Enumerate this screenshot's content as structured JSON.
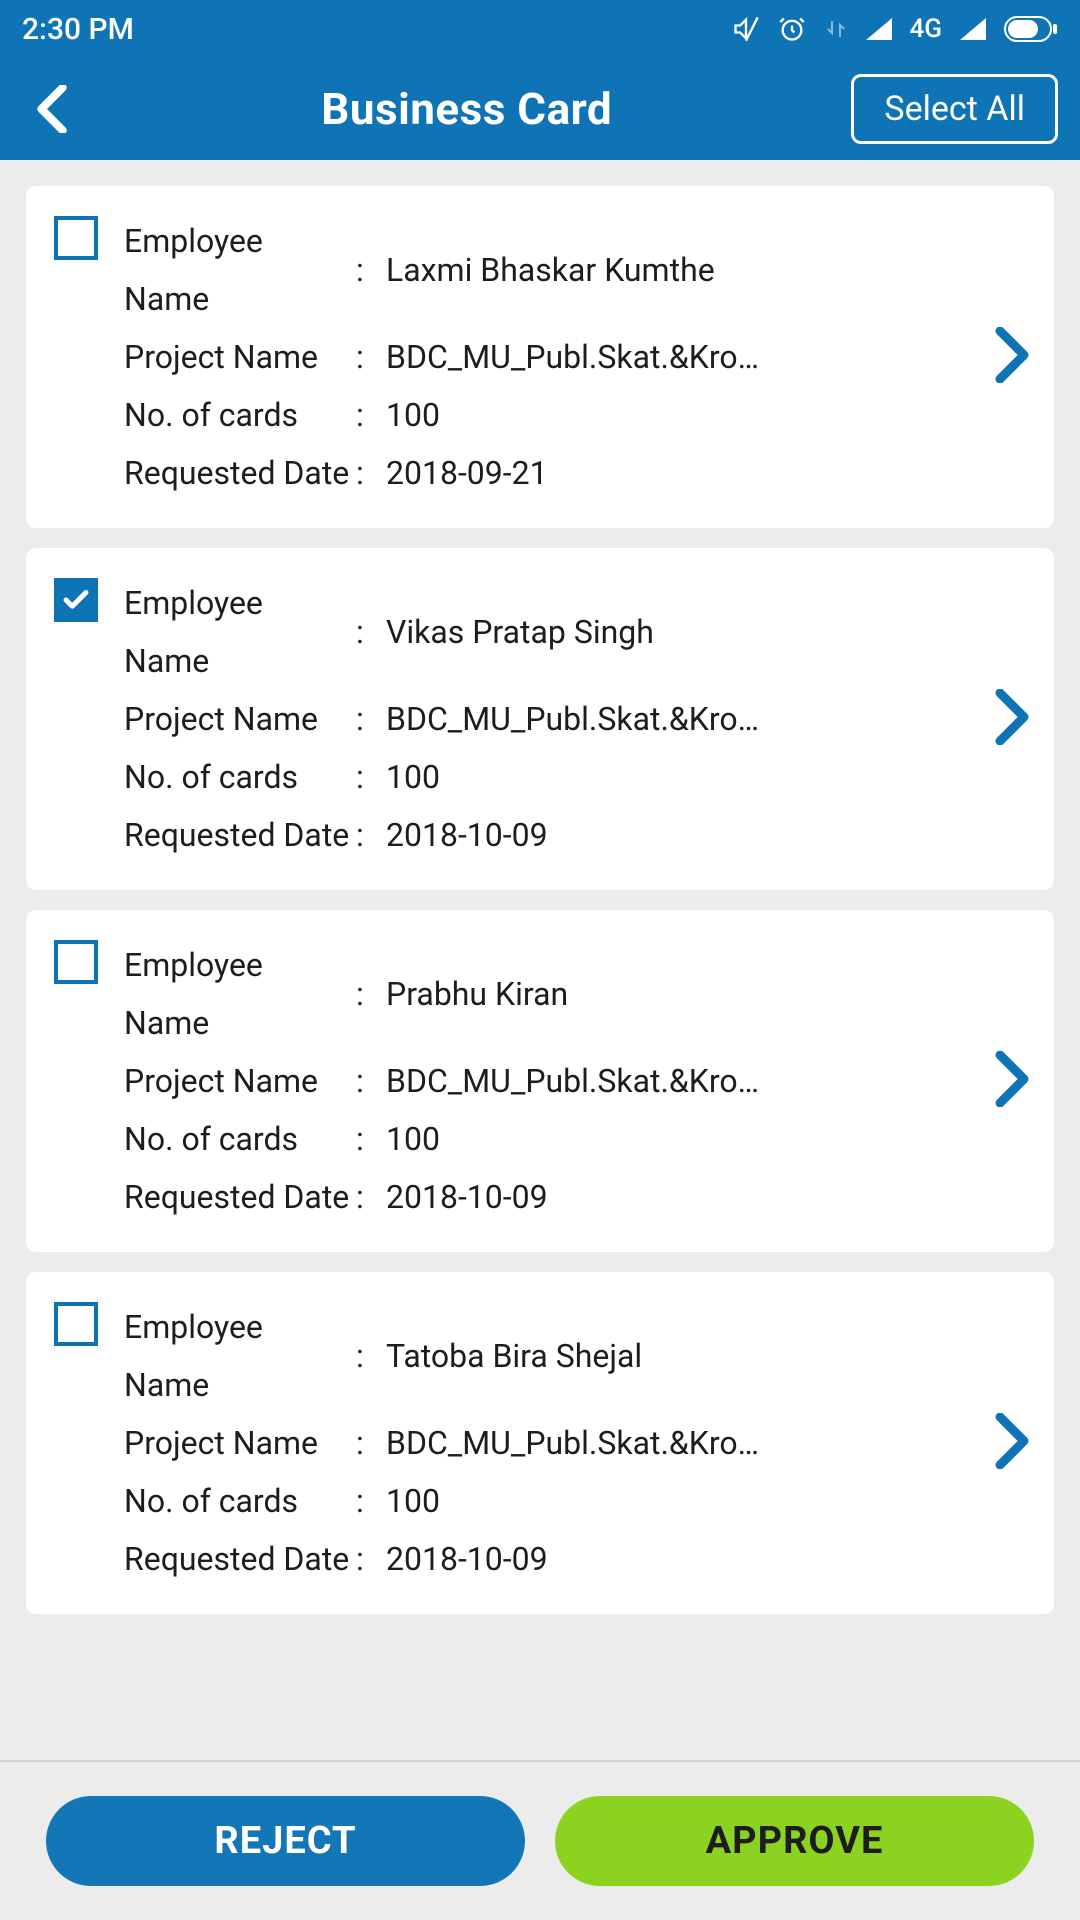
{
  "statusbar": {
    "time": "2:30 PM",
    "network_label": "4G"
  },
  "header": {
    "title": "Business Card",
    "select_all_label": "Select All"
  },
  "labels": {
    "employee": "Employee Name",
    "project": "Project Name",
    "cards": "No. of cards",
    "date": "Requested Date"
  },
  "items": [
    {
      "checked": false,
      "employee": "Laxmi Bhaskar Kumthe",
      "project": "BDC_MU_Publ.Skat.&Kro…",
      "cards": "100",
      "date": "2018-09-21"
    },
    {
      "checked": true,
      "employee": "Vikas Pratap  Singh",
      "project": "BDC_MU_Publ.Skat.&Kro…",
      "cards": "100",
      "date": "2018-10-09"
    },
    {
      "checked": false,
      "employee": "Prabhu  Kiran",
      "project": "BDC_MU_Publ.Skat.&Kro…",
      "cards": "100",
      "date": "2018-10-09"
    },
    {
      "checked": false,
      "employee": "Tatoba Bira  Shejal",
      "project": "BDC_MU_Publ.Skat.&Kro…",
      "cards": "100",
      "date": "2018-10-09"
    }
  ],
  "actions": {
    "reject": "REJECT",
    "approve": "APPROVE"
  }
}
